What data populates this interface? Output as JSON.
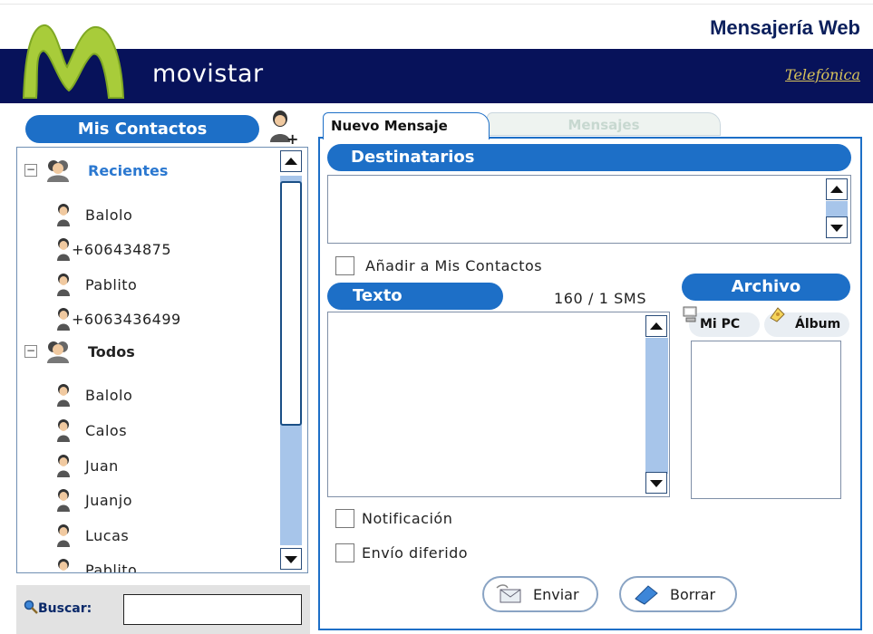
{
  "header": {
    "app_title": "Mensajería Web",
    "brand": "movistar",
    "partner": "Telefónica",
    "colors": {
      "band": "#07125a",
      "accent": "#1d6fc7"
    }
  },
  "contacts": {
    "title": "Mis Contactos",
    "groups": [
      {
        "label": "Recientes",
        "items": [
          "Balolo",
          "+606434875",
          "Pablito",
          "+6063436499"
        ]
      },
      {
        "label": "Todos",
        "items": [
          "Balolo",
          "Calos",
          "Juan",
          "Juanjo",
          "Lucas",
          "Pablito"
        ]
      }
    ],
    "search_label": "Buscar:",
    "search_value": ""
  },
  "tabs": [
    "Nuevo Mensaje",
    "Mensajes"
  ],
  "compose": {
    "recipients_label": "Destinatarios",
    "add_to_contacts": "Añadir a Mis Contactos",
    "text_label": "Texto",
    "counter": "160 / 1 SMS",
    "file_label": "Archivo",
    "my_pc": "Mi PC",
    "album": "Álbum",
    "notification": "Notificación",
    "deferred": "Envío diferido",
    "send": "Enviar",
    "clear": "Borrar"
  }
}
